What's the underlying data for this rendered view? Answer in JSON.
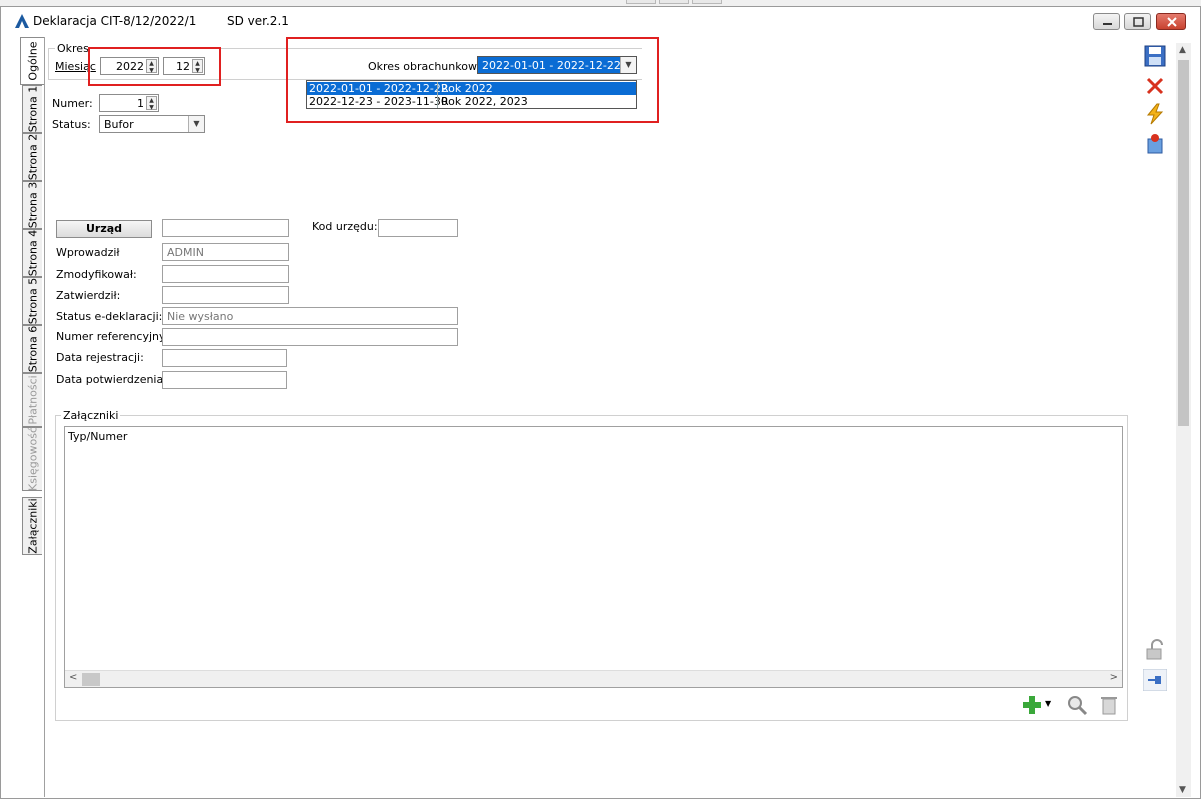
{
  "window": {
    "title": "Deklaracja CIT-8/12/2022/1",
    "version": "SD ver.2.1"
  },
  "side_tabs": [
    {
      "label": "Ogólne",
      "active": true,
      "enabled": true
    },
    {
      "label": "Strona 1",
      "active": false,
      "enabled": true
    },
    {
      "label": "Strona 2",
      "active": false,
      "enabled": true
    },
    {
      "label": "Strona 3",
      "active": false,
      "enabled": true
    },
    {
      "label": "Strona 4",
      "active": false,
      "enabled": true
    },
    {
      "label": "Strona 5",
      "active": false,
      "enabled": true
    },
    {
      "label": "Strona 6",
      "active": false,
      "enabled": true
    },
    {
      "label": "Płatności",
      "active": false,
      "enabled": false
    },
    {
      "label": "Księgowość",
      "active": false,
      "enabled": false
    },
    {
      "label": "Załączniki",
      "active": false,
      "enabled": true
    }
  ],
  "okres": {
    "group_label": "Okres",
    "miesiac_label": "Miesiąc",
    "year": "2022",
    "month": "12"
  },
  "okres_obrachunkowy": {
    "label": "Okres obrachunkowy:",
    "selected": "2022-01-01 - 2022-12-22",
    "options": [
      {
        "range": "2022-01-01 - 2022-12-22",
        "name": "Rok 2022",
        "highlighted": true
      },
      {
        "range": "2022-12-23 - 2023-11-30",
        "name": "Rok 2022, 2023",
        "highlighted": false
      }
    ]
  },
  "numer": {
    "label": "Numer:",
    "value": "1"
  },
  "status": {
    "label": "Status:",
    "value": "Bufor"
  },
  "urzad": {
    "button_label": "Urząd",
    "value": "",
    "kod_label": "Kod urzędu:",
    "kod_value": ""
  },
  "info_fields": [
    {
      "label": "Wprowadził",
      "value": "ADMIN"
    },
    {
      "label": "Zmodyfikował:",
      "value": ""
    },
    {
      "label": "Zatwierdził:",
      "value": ""
    },
    {
      "label": "Status e-deklaracji:",
      "value": "Nie wysłano"
    },
    {
      "label": "Numer referencyjny",
      "value": ""
    },
    {
      "label": "Data rejestracji:",
      "value": ""
    },
    {
      "label": "Data potwierdzenia:",
      "value": ""
    }
  ],
  "zalaczniki": {
    "group_label": "Załączniki",
    "column_header": "Typ/Numer"
  },
  "icons": {
    "save": "save-icon",
    "cancel": "close-icon",
    "lightning": "lightning-icon",
    "export": "export-icon",
    "lock": "lock-icon",
    "pin": "pin-icon",
    "add": "plus-icon",
    "preview": "magnifier-icon",
    "delete": "trash-icon"
  },
  "colors": {
    "highlight": "#0a6cd4",
    "annotation_red": "#e02020"
  }
}
